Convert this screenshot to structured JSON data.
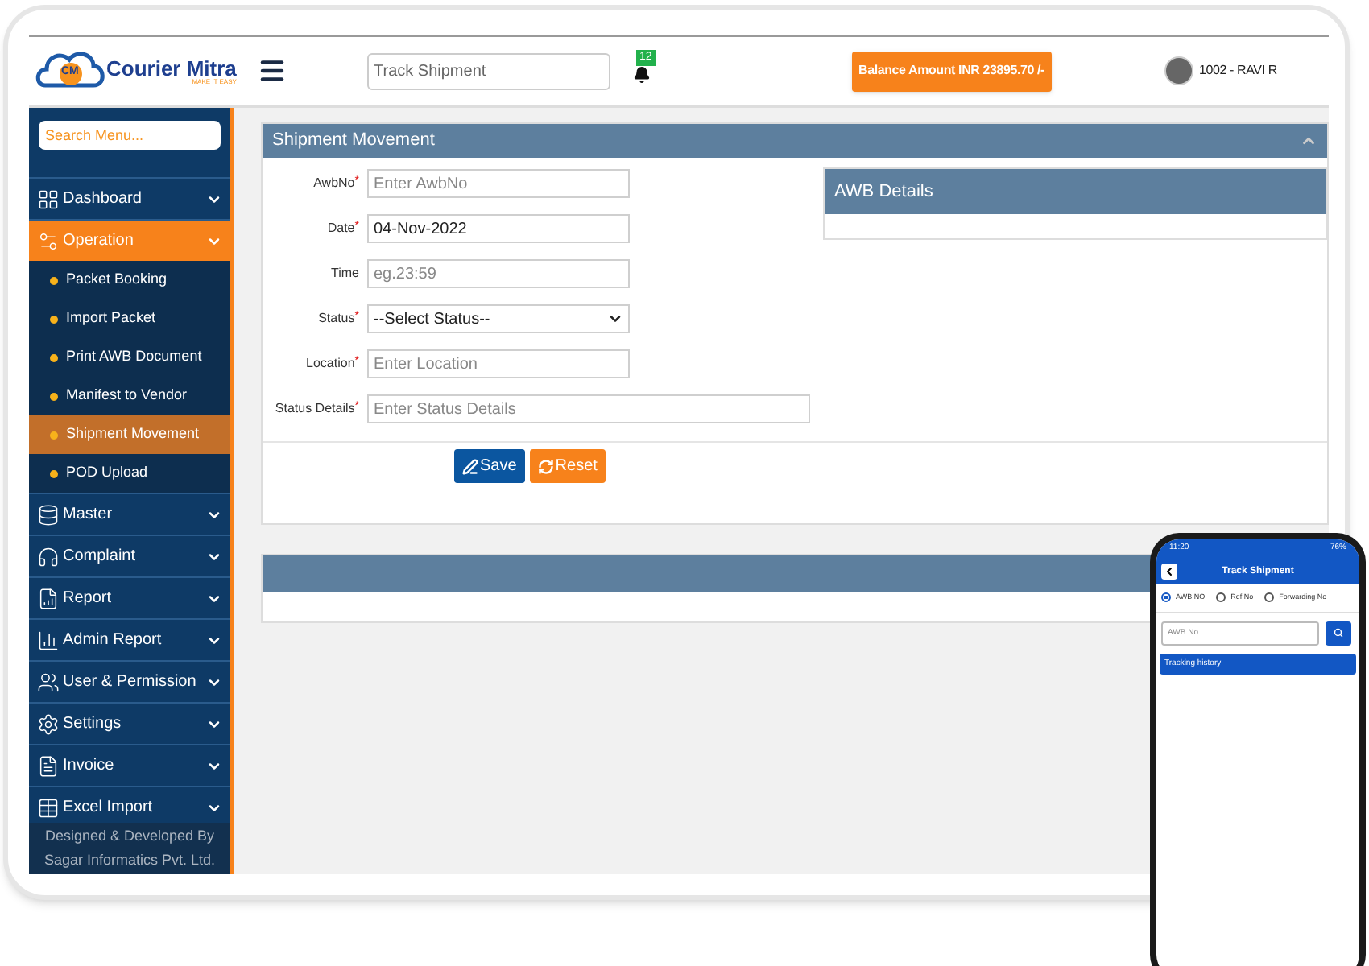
{
  "logo": {
    "mark": "CM",
    "name": "Courier Mitra",
    "tagline": "MAKE IT EASY"
  },
  "header": {
    "search": {
      "placeholder": "Track Shipment"
    },
    "notifications": "12",
    "balance": "Balance Amount INR 23895.70 /-",
    "user": "1002 - RAVI R"
  },
  "sidebar": {
    "search": {
      "placeholder": "Search Menu..."
    },
    "items": [
      {
        "label": "Dashboard",
        "expanded": false
      },
      {
        "label": "Operation",
        "expanded": true,
        "children": [
          {
            "label": "Packet Booking",
            "selected": false
          },
          {
            "label": "Import Packet",
            "selected": false
          },
          {
            "label": "Print AWB Document",
            "selected": false
          },
          {
            "label": "Manifest to Vendor",
            "selected": false
          },
          {
            "label": "Shipment Movement",
            "selected": true
          },
          {
            "label": "POD Upload",
            "selected": false
          }
        ]
      },
      {
        "label": "Master",
        "expanded": false
      },
      {
        "label": "Complaint",
        "expanded": false
      },
      {
        "label": "Report",
        "expanded": false
      },
      {
        "label": "Admin Report",
        "expanded": false
      },
      {
        "label": "User & Permission",
        "expanded": false
      },
      {
        "label": "Settings",
        "expanded": false
      },
      {
        "label": "Invoice",
        "expanded": false
      },
      {
        "label": "Excel Import",
        "expanded": false
      }
    ],
    "footer": [
      "Designed & Developed By",
      "Sagar Informatics Pvt. Ltd."
    ]
  },
  "form": {
    "title": "Shipment Movement",
    "fields": [
      {
        "kind": "text",
        "label": "AwbNo",
        "required_mark": "*",
        "placeholder": "Enter AwbNo"
      },
      {
        "kind": "text",
        "label": "Date",
        "required_mark": "*",
        "value": "04-Nov-2022"
      },
      {
        "kind": "text",
        "label": "Time",
        "placeholder": "eg.23:59"
      },
      {
        "kind": "select",
        "label": "Status",
        "required_mark": "*",
        "value": "--Select Status--"
      },
      {
        "kind": "text",
        "label": "Location",
        "required_mark": "*",
        "placeholder": "Enter Location"
      },
      {
        "kind": "wide",
        "label": "Status Details",
        "required_mark": "*",
        "placeholder": "Enter Status Details"
      }
    ],
    "awb_panel": {
      "title": "AWB Details"
    },
    "buttons": [
      {
        "kind": "save",
        "label": "Save"
      },
      {
        "kind": "reset",
        "label": "Reset"
      }
    ]
  },
  "phone": {
    "time": "11:20",
    "battery": "76%",
    "title": "Track Shipment",
    "options": [
      {
        "label": "AWB NO",
        "selected": true
      },
      {
        "label": "Ref No",
        "selected": false
      },
      {
        "label": "Forwarding No",
        "selected": false
      }
    ],
    "search": {
      "placeholder": "AWB No"
    },
    "history": "Tracking history"
  }
}
